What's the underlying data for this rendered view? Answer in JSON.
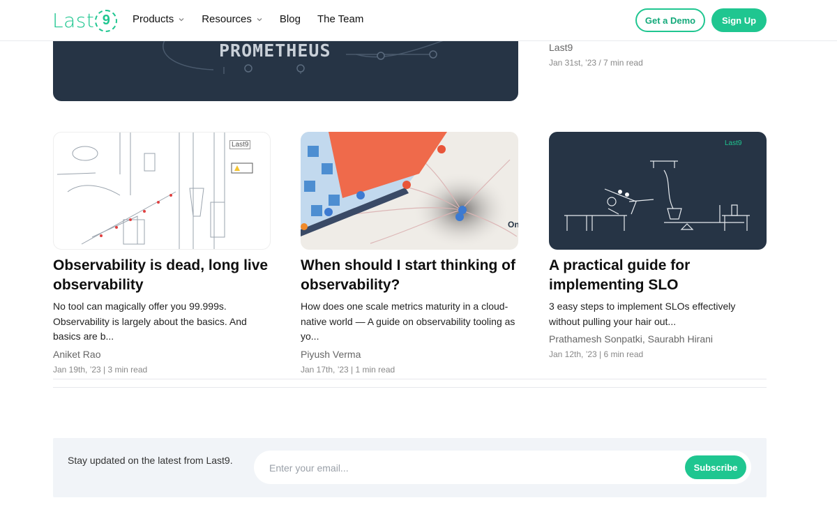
{
  "brand": {
    "logo_text": "Last",
    "logo_digit": "9",
    "accent": "#1fc690"
  },
  "nav": {
    "items": [
      {
        "label": "Products",
        "dropdown": true
      },
      {
        "label": "Resources",
        "dropdown": true
      },
      {
        "label": "Blog",
        "dropdown": false
      },
      {
        "label": "The Team",
        "dropdown": false
      }
    ],
    "demo_label": "Get a Demo",
    "signup_label": "Sign Up"
  },
  "top_post": {
    "image_text": "PROMETHEUS",
    "author": "Last9",
    "meta": "Jan 31st, ’23 / 7 min read"
  },
  "posts": [
    {
      "title": "Observability is dead, long live observability",
      "excerpt": "No tool can magically offer you 99.999s. Observability is largely about the basics. And basics are b...",
      "author": "Aniket Rao",
      "meta": "Jan 19th, ’23 | 3 min read",
      "image_badge": "Last9"
    },
    {
      "title": "When should I start thinking of observability?",
      "excerpt": "How does one scale metrics maturity in a cloud-native world — A guide on observability tooling as yo...",
      "author": "Piyush Verma",
      "meta": "Jan 17th, ’23 | 1 min read",
      "image_badge": "On"
    },
    {
      "title": "A practical guide for implementing SLO",
      "excerpt": "3 easy steps to implement SLOs effectively without pulling your hair out...",
      "author": "Prathamesh Sonpatki, Saurabh Hirani",
      "meta": "Jan 12th, ’23 | 6 min read",
      "image_badge": "Last9"
    }
  ],
  "subscribe": {
    "text": "Stay updated on the latest from Last9.",
    "placeholder": "Enter your email...",
    "button_label": "Subscribe"
  }
}
